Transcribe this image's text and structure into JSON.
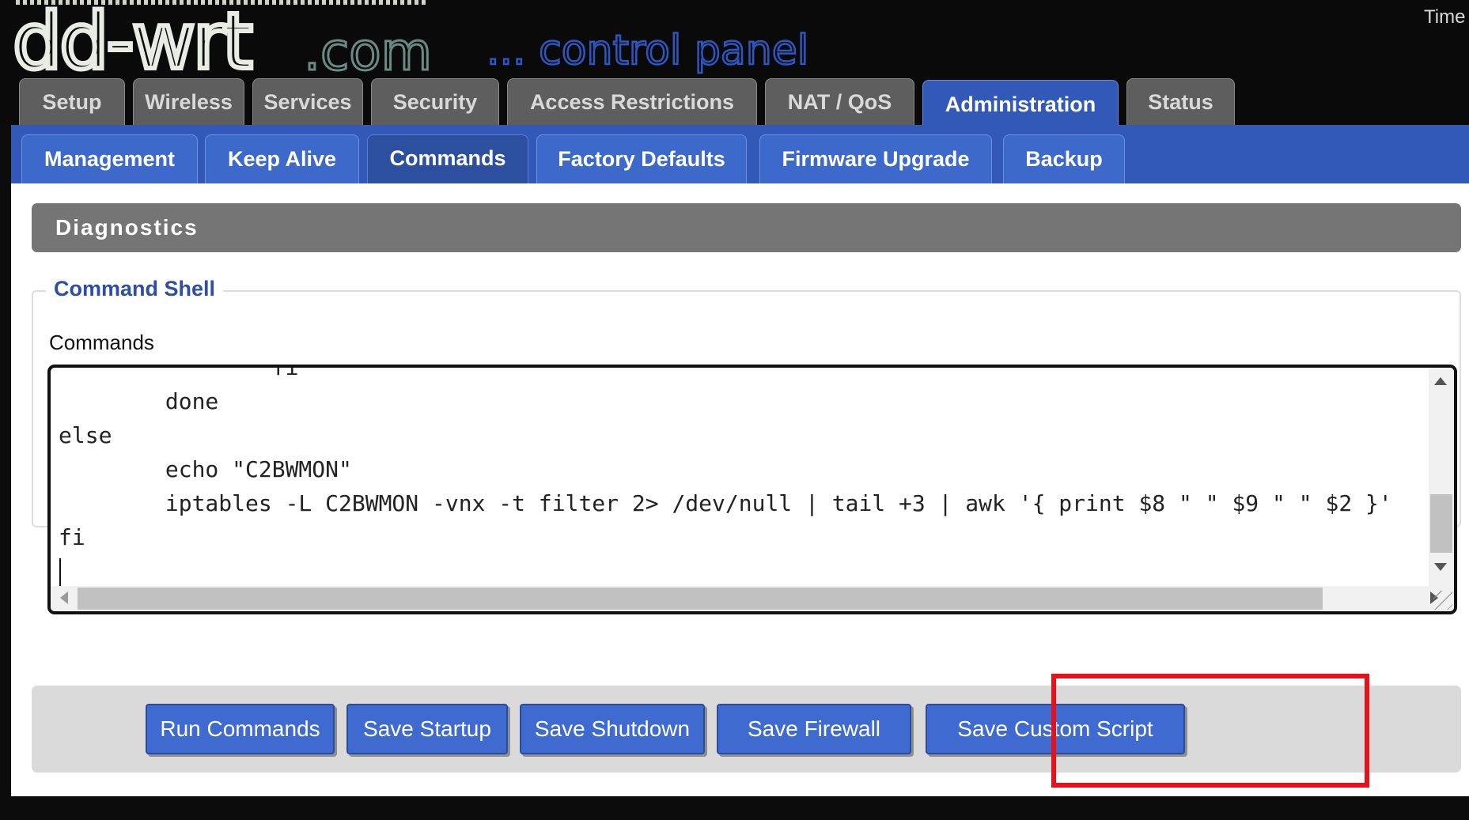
{
  "header": {
    "logo_text": "dd-wrt",
    "logo_suffix": ".com",
    "tagline": "... control panel",
    "time_label": "Time"
  },
  "main_tabs": [
    {
      "label": "Setup",
      "active": false
    },
    {
      "label": "Wireless",
      "active": false
    },
    {
      "label": "Services",
      "active": false
    },
    {
      "label": "Security",
      "active": false
    },
    {
      "label": "Access Restrictions",
      "active": false
    },
    {
      "label": "NAT / QoS",
      "active": false
    },
    {
      "label": "Administration",
      "active": true
    },
    {
      "label": "Status",
      "active": false
    }
  ],
  "sub_tabs": [
    {
      "label": "Management",
      "active": false
    },
    {
      "label": "Keep Alive",
      "active": false
    },
    {
      "label": "Commands",
      "active": true
    },
    {
      "label": "Factory Defaults",
      "active": false
    },
    {
      "label": "Firmware Upgrade",
      "active": false
    },
    {
      "label": "Backup",
      "active": false
    }
  ],
  "section": {
    "title": "Diagnostics",
    "fieldset_legend": "Command Shell",
    "commands_label": "Commands",
    "commands_text": "                fi\n        done\nelse\n        echo \"C2BWMON\"\n        iptables -L C2BWMON -vnx -t filter 2> /dev/null | tail +3 | awk '{ print $8 \" \" $9 \" \" $2 }'\nfi\n"
  },
  "buttons": {
    "run_commands": "Run Commands",
    "save_startup": "Save Startup",
    "save_shutdown": "Save Shutdown",
    "save_firewall": "Save Firewall",
    "save_custom_script": "Save Custom Script"
  },
  "colors": {
    "accent_blue": "#3259b7",
    "highlight_red": "#e8101a"
  },
  "icons": {
    "scroll_up": "scroll-up-arrow-icon",
    "scroll_down": "scroll-down-arrow-icon",
    "scroll_left": "scroll-left-arrow-icon",
    "scroll_right": "scroll-right-arrow-icon",
    "resize": "resize-grip-icon"
  }
}
